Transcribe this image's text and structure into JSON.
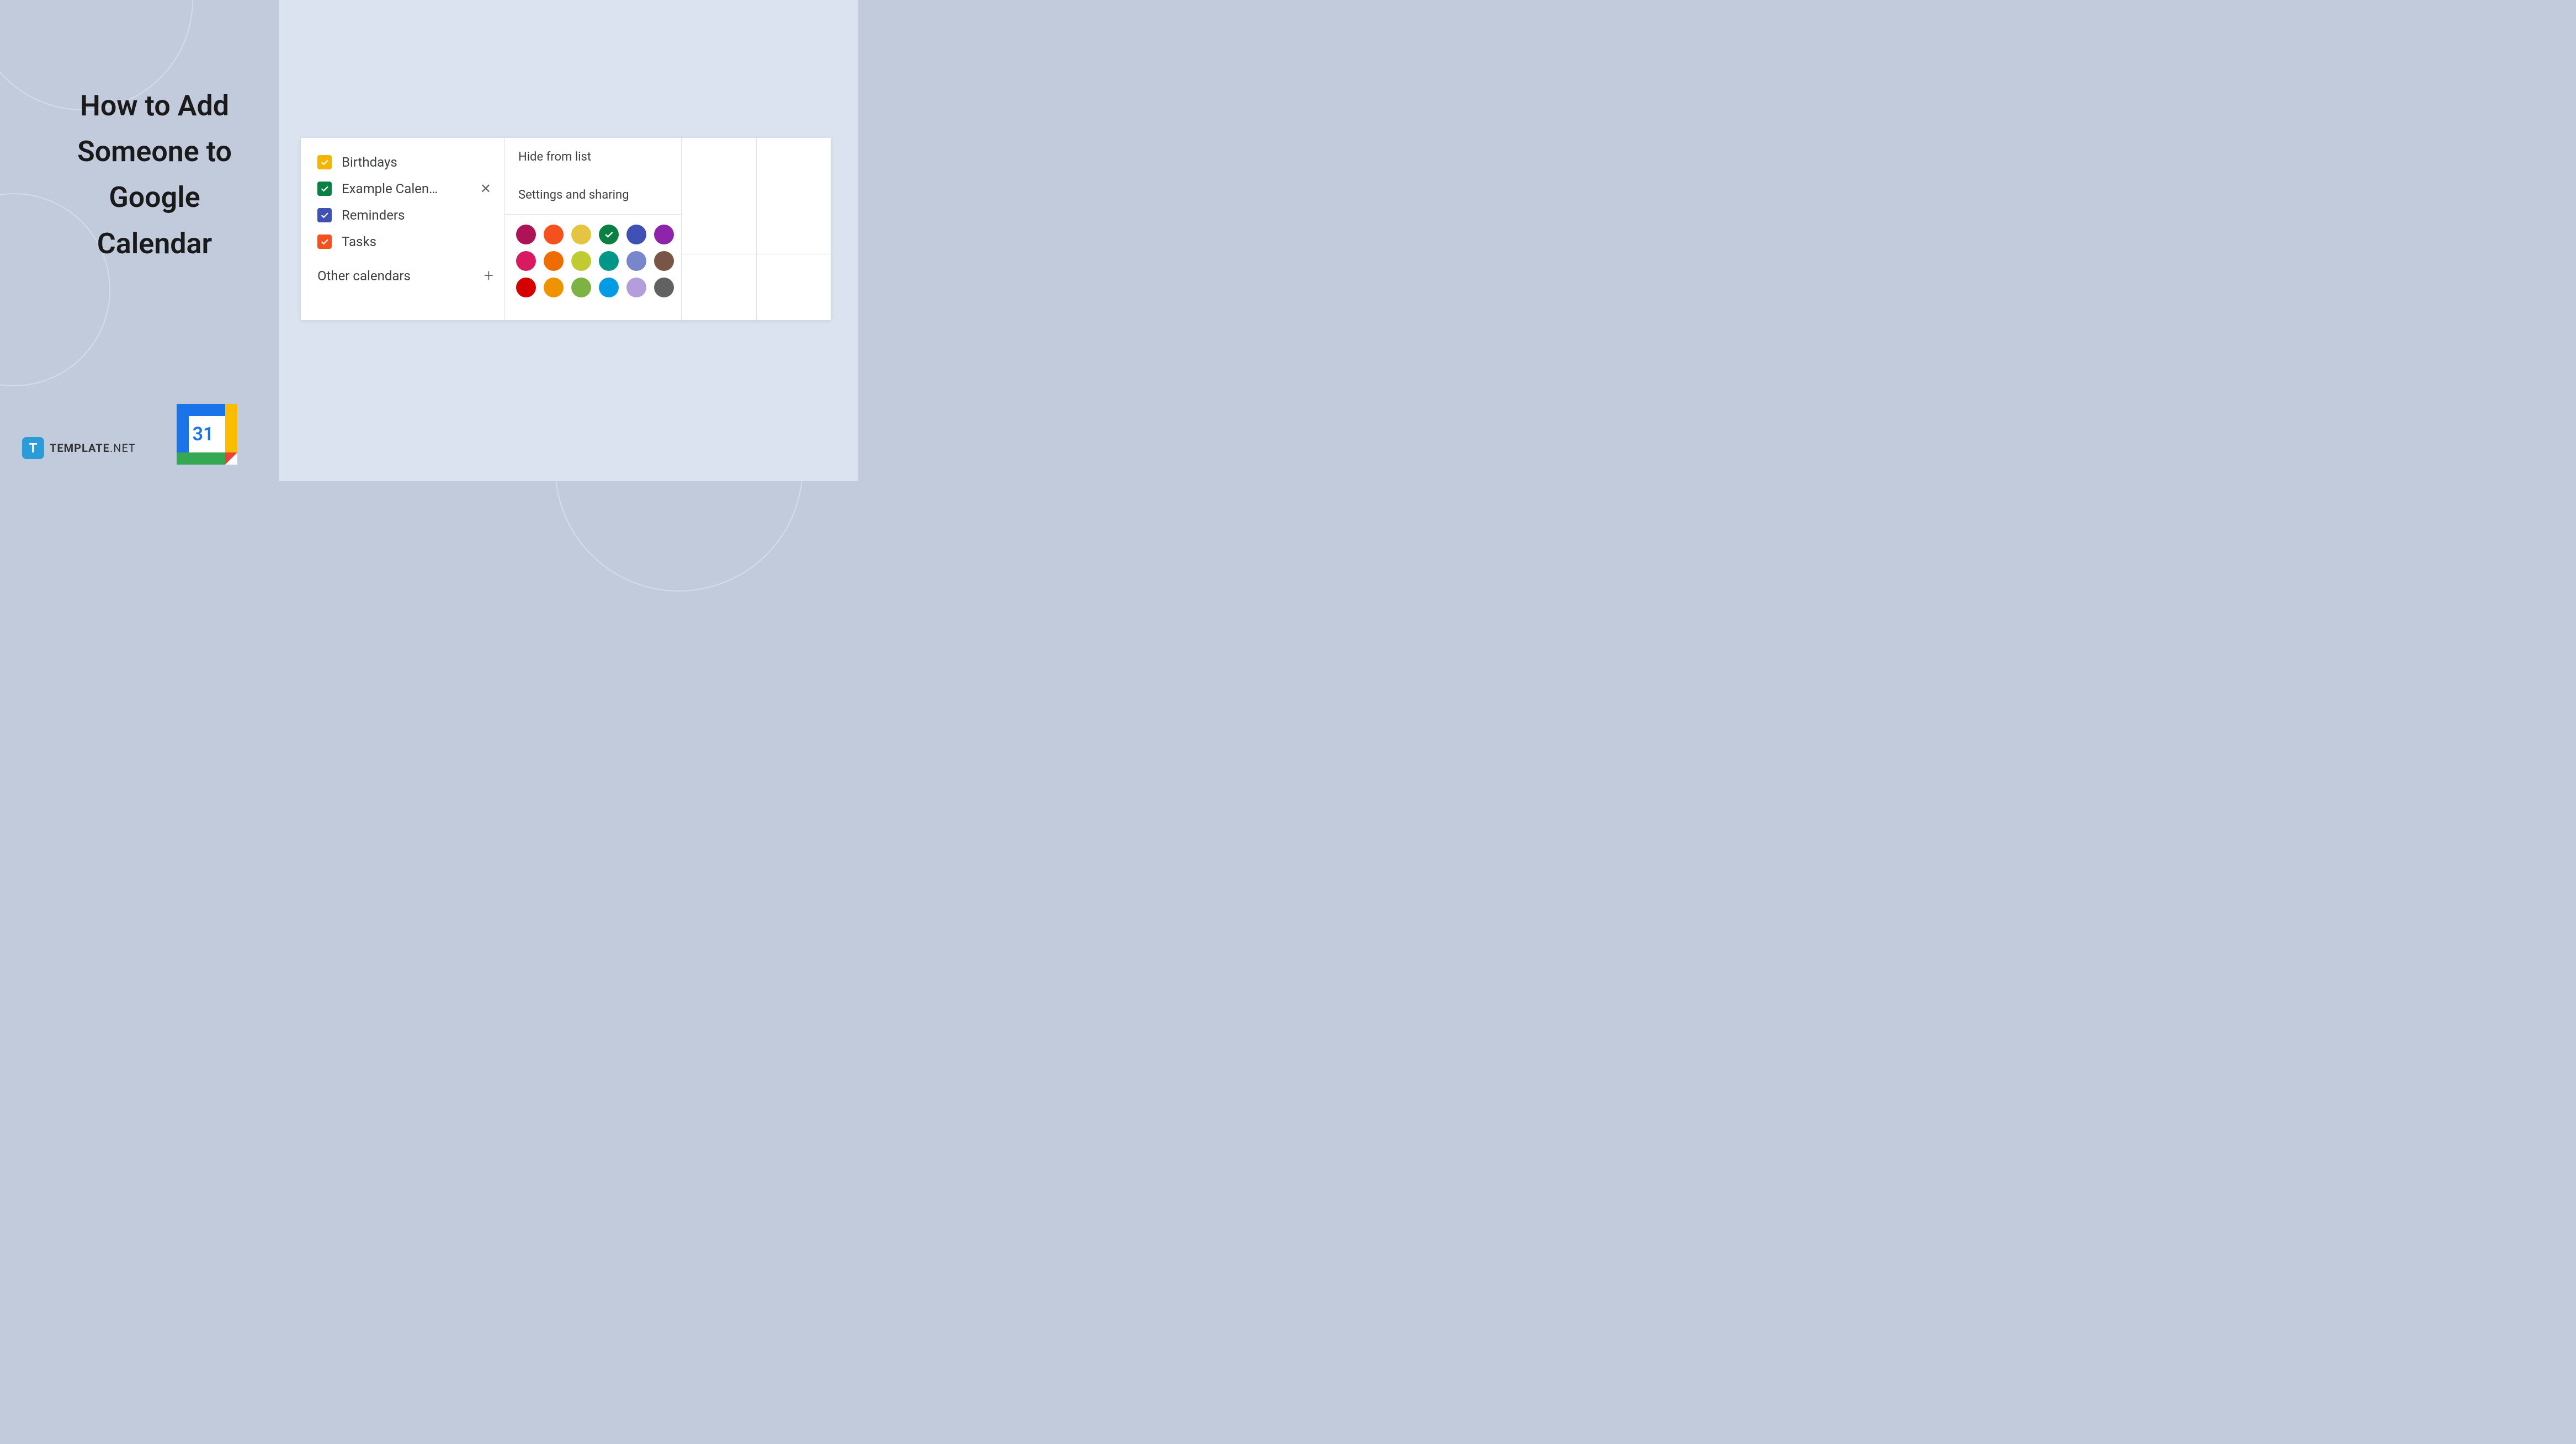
{
  "title": "How to Add Someone to Google Calendar",
  "brand": {
    "logo_letter": "T",
    "name": "TEMPLATE",
    "suffix": ".NET"
  },
  "gcal_day": "31",
  "calendars": [
    {
      "label": "Birthdays",
      "color": "#f4b400",
      "checked": true,
      "hovered": false
    },
    {
      "label": "Example Calen…",
      "color": "#0b8043",
      "checked": true,
      "hovered": true
    },
    {
      "label": "Reminders",
      "color": "#3f51b5",
      "checked": true,
      "hovered": false
    },
    {
      "label": "Tasks",
      "color": "#f4511e",
      "checked": true,
      "hovered": false
    }
  ],
  "other_calendars_label": "Other calendars",
  "menu": {
    "hide": "Hide from list",
    "settings": "Settings and sharing"
  },
  "colors": [
    {
      "hex": "#ad1457",
      "selected": false
    },
    {
      "hex": "#f4511e",
      "selected": false
    },
    {
      "hex": "#e4c441",
      "selected": false
    },
    {
      "hex": "#0b8043",
      "selected": true
    },
    {
      "hex": "#3f51b5",
      "selected": false
    },
    {
      "hex": "#8e24aa",
      "selected": false
    },
    {
      "hex": "#d81b60",
      "selected": false
    },
    {
      "hex": "#ef6c00",
      "selected": false
    },
    {
      "hex": "#c0ca33",
      "selected": false
    },
    {
      "hex": "#009688",
      "selected": false
    },
    {
      "hex": "#7986cb",
      "selected": false
    },
    {
      "hex": "#795548",
      "selected": false
    },
    {
      "hex": "#d50000",
      "selected": false
    },
    {
      "hex": "#f09300",
      "selected": false
    },
    {
      "hex": "#7cb342",
      "selected": false
    },
    {
      "hex": "#039be5",
      "selected": false
    },
    {
      "hex": "#b39ddb",
      "selected": false
    },
    {
      "hex": "#616161",
      "selected": false
    }
  ]
}
